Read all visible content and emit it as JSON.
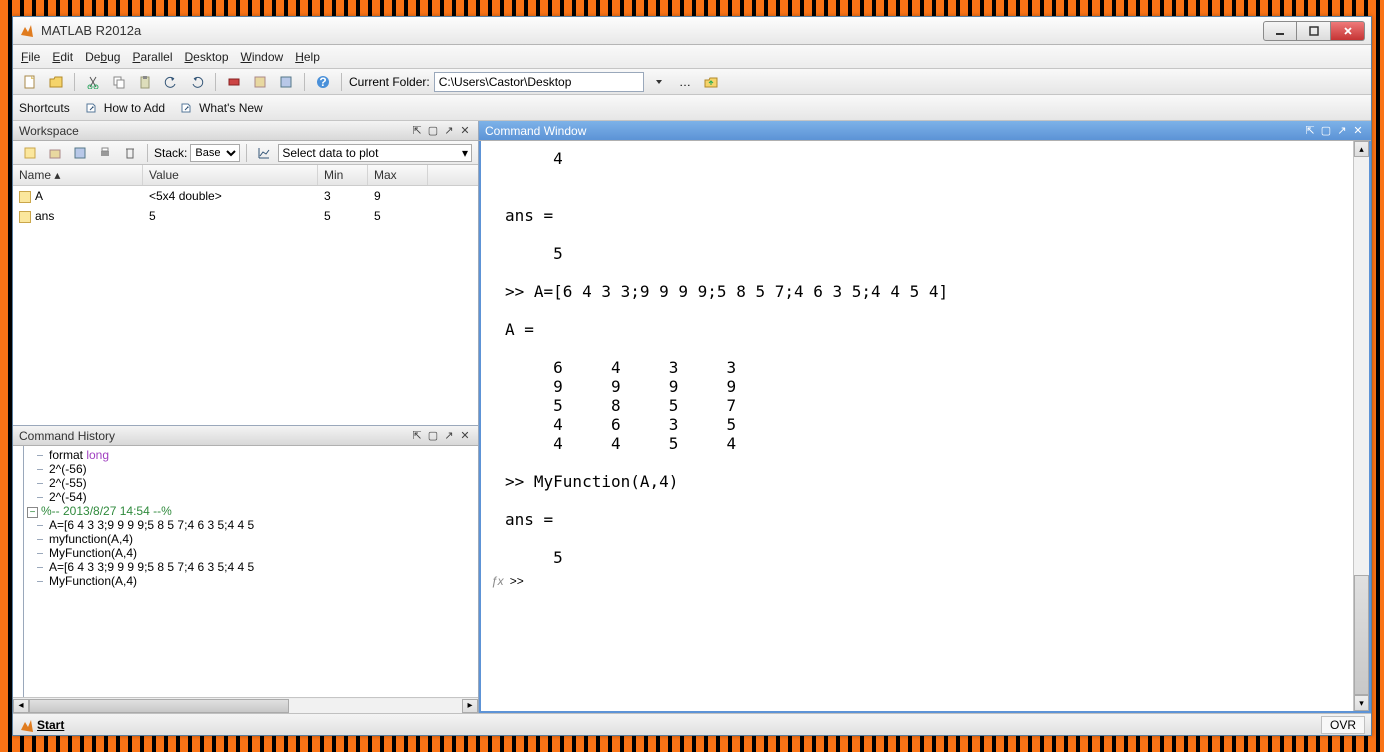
{
  "window": {
    "title": "MATLAB R2012a"
  },
  "menus": [
    "File",
    "Edit",
    "Debug",
    "Parallel",
    "Desktop",
    "Window",
    "Help"
  ],
  "toolbar": {
    "current_folder_label": "Current Folder:",
    "current_folder_path": "C:\\Users\\Castor\\Desktop"
  },
  "shortcuts": {
    "label": "Shortcuts",
    "how_to_add": "How to Add",
    "whats_new": "What's New"
  },
  "workspace": {
    "title": "Workspace",
    "stack_label": "Stack:",
    "stack_value": "Base",
    "plot_label": "Select data to plot",
    "columns": {
      "name": "Name",
      "value": "Value",
      "min": "Min",
      "max": "Max"
    },
    "rows": [
      {
        "name": "A",
        "value": "<5x4 double>",
        "min": "3",
        "max": "9"
      },
      {
        "name": "ans",
        "value": "5",
        "min": "5",
        "max": "5"
      }
    ]
  },
  "history": {
    "title": "Command History",
    "lines": [
      {
        "text": "format ",
        "kw": "long"
      },
      {
        "text": "2^(-56)"
      },
      {
        "text": "2^(-55)"
      },
      {
        "text": "2^(-54)"
      }
    ],
    "session": "%-- 2013/8/27 14:54 --%",
    "lines2": [
      "A=[6 4 3 3;9 9 9 9;5 8 5 7;4 6 3 5;4 4 5",
      "myfunction(A,4)",
      "MyFunction(A,4)",
      "A=[6 4 3 3;9 9 9 9;5 8 5 7;4 6 3 5;4 4 5",
      "MyFunction(A,4)"
    ]
  },
  "command_window": {
    "title": "Command Window",
    "output_lines": [
      "     4",
      "",
      "",
      "ans =",
      "",
      "     5",
      "",
      ">> A=[6 4 3 3;9 9 9 9;5 8 5 7;4 6 3 5;4 4 5 4]",
      "",
      "A =",
      "",
      "     6     4     3     3",
      "     9     9     9     9",
      "     5     8     5     7",
      "     4     6     3     5",
      "     4     4     5     4",
      "",
      ">> MyFunction(A,4)",
      "",
      "ans =",
      "",
      "     5"
    ],
    "prompt": ">>"
  },
  "status": {
    "start": "Start",
    "ovr": "OVR"
  }
}
